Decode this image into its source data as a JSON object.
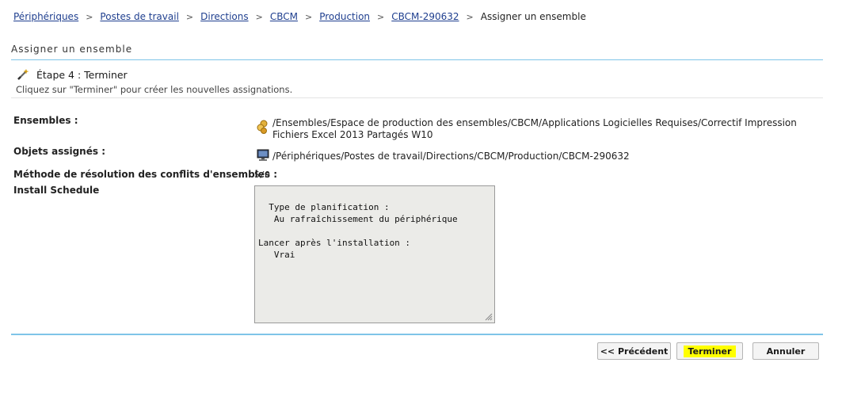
{
  "breadcrumb": {
    "items": [
      "Périphériques",
      "Postes de travail",
      "Directions",
      "CBCM",
      "Production",
      "CBCM-290632"
    ],
    "current": "Assigner un ensemble"
  },
  "section_title": "Assigner un ensemble",
  "step": {
    "title": "Étape 4 : Terminer",
    "description": "Cliquez sur \"Terminer\" pour créer les nouvelles assignations."
  },
  "fields": {
    "ensembles_label": "Ensembles :",
    "ensembles_value_line1": "/Ensembles/Espace de production des ensembles/CBCM/Applications Logicielles Requises/Correctif Impression",
    "ensembles_value_line2": "Fichiers Excel 2013 Partagés W10",
    "objets_label": "Objets assignés :",
    "objets_value": "/Périphériques/Postes de travail/Directions/CBCM/Production/CBCM-290632",
    "methode_label": "Méthode de résolution des conflits d'ensembles :",
    "methode_value": "S/O",
    "schedule_label": "Install Schedule",
    "schedule_text": "Type de planification :\n   Au rafraîchissement du périphérique\n\nLancer après l'installation :\n   Vrai"
  },
  "buttons": {
    "previous": "<< Précédent",
    "finish": "Terminer",
    "cancel": "Annuler"
  },
  "colors": {
    "link": "#1f3f8f",
    "rule": "#7fc4e8",
    "highlight": "#ffff00"
  },
  "icons": {
    "step": "wand-icon",
    "bundle": "bundle-icon",
    "device": "computer-icon"
  }
}
